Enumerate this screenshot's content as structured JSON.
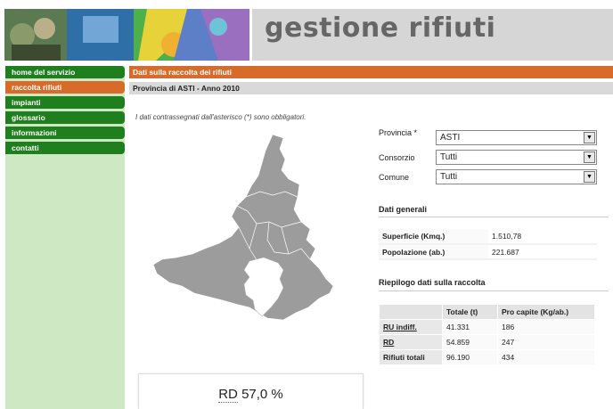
{
  "banner": {
    "title": "gestione rifiuti"
  },
  "sidebar": {
    "items": [
      {
        "label": "home del servizio",
        "active": false
      },
      {
        "label": "raccolta rifiuti",
        "active": true
      },
      {
        "label": "impianti",
        "active": false
      },
      {
        "label": "glossario",
        "active": false
      },
      {
        "label": "informazioni",
        "active": false
      },
      {
        "label": "contatti",
        "active": false
      }
    ]
  },
  "header": {
    "title": "Dati sulla raccolta dei rifiuti",
    "subtitle": "Provincia di ASTI - Anno 2010"
  },
  "note": "I dati contrassegnati dall'asterisco (*) sono obbligatori.",
  "filters": {
    "provincia": {
      "label": "Provincia *",
      "value": "ASTI"
    },
    "consorzio": {
      "label": "Consorzio",
      "value": "Tutti"
    },
    "comune": {
      "label": "Comune",
      "value": "Tutti"
    }
  },
  "dati_generali": {
    "title": "Dati generali",
    "rows": [
      {
        "label": "Superficie (Kmq.)",
        "value": "1.510,78"
      },
      {
        "label": "Popolazione (ab.)",
        "value": "221.687"
      }
    ]
  },
  "riepilogo": {
    "title": "Riepilogo dati sulla raccolta",
    "headers": [
      "",
      "Totale (t)",
      "Pro capite (Kg/ab.)"
    ],
    "rows": [
      {
        "label": "RU indiff.",
        "totale": "41.331",
        "pro_capite": "186"
      },
      {
        "label": "RD",
        "totale": "54.859",
        "pro_capite": "247"
      },
      {
        "label": "Rifiuti totali",
        "totale": "96.190",
        "pro_capite": "434"
      }
    ]
  },
  "rd_percent": {
    "prefix": "RD",
    "value": "57,0 %"
  },
  "colors": {
    "nav_green": "#1f7e1d",
    "nav_active": "#d86a2a",
    "sidebar_bg": "#cfe8c4",
    "map_fill": "#9c9c9c",
    "map_selected": "#ffffff"
  }
}
